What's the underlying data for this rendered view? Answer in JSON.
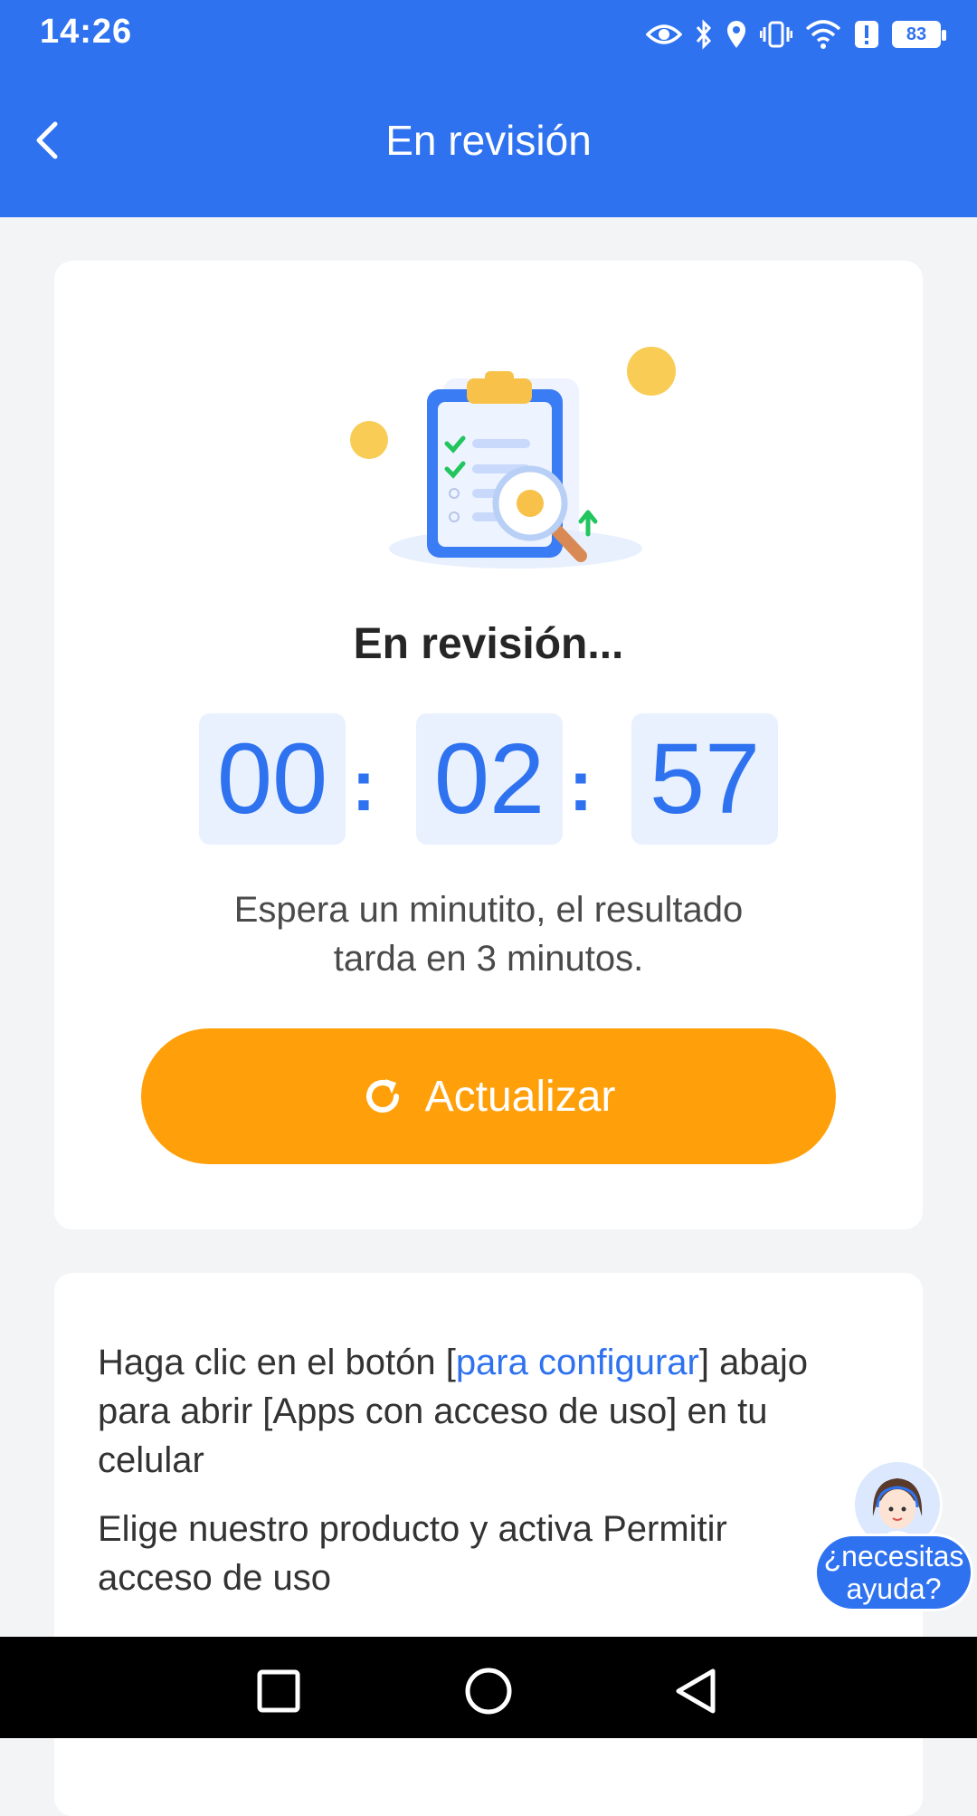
{
  "status_bar": {
    "time": "14:26",
    "battery": "83",
    "icons": [
      "eye-icon",
      "bluetooth-icon",
      "location-icon",
      "vibrate-icon",
      "wifi-icon",
      "alert-icon",
      "battery-icon"
    ]
  },
  "header": {
    "title": "En revisión",
    "back_icon": "chevron-left-icon"
  },
  "review": {
    "title": "En revisión...",
    "timer": {
      "hours": "00",
      "minutes": "02",
      "seconds": "57",
      "separator": ":"
    },
    "message_line1": "Espera un minutito, el resultado",
    "message_line2": "tarda en 3 minutos.",
    "refresh_label": "Actualizar",
    "refresh_icon": "refresh-icon"
  },
  "instructions": {
    "line1_prefix": "Haga clic en el botón [",
    "line1_link": "para configurar",
    "line1_suffix": "] abajo para abrir [Apps con acceso de uso] en tu celular",
    "line2": "Elige nuestro producto y activa Permitir acceso de uso"
  },
  "help": {
    "line1": "¿necesitas",
    "line2": "ayuda?"
  },
  "colors": {
    "primary": "#2f72f0",
    "accent": "#ffa00a",
    "timer_bg": "#e9f1fe",
    "background": "#f3f4f6"
  }
}
